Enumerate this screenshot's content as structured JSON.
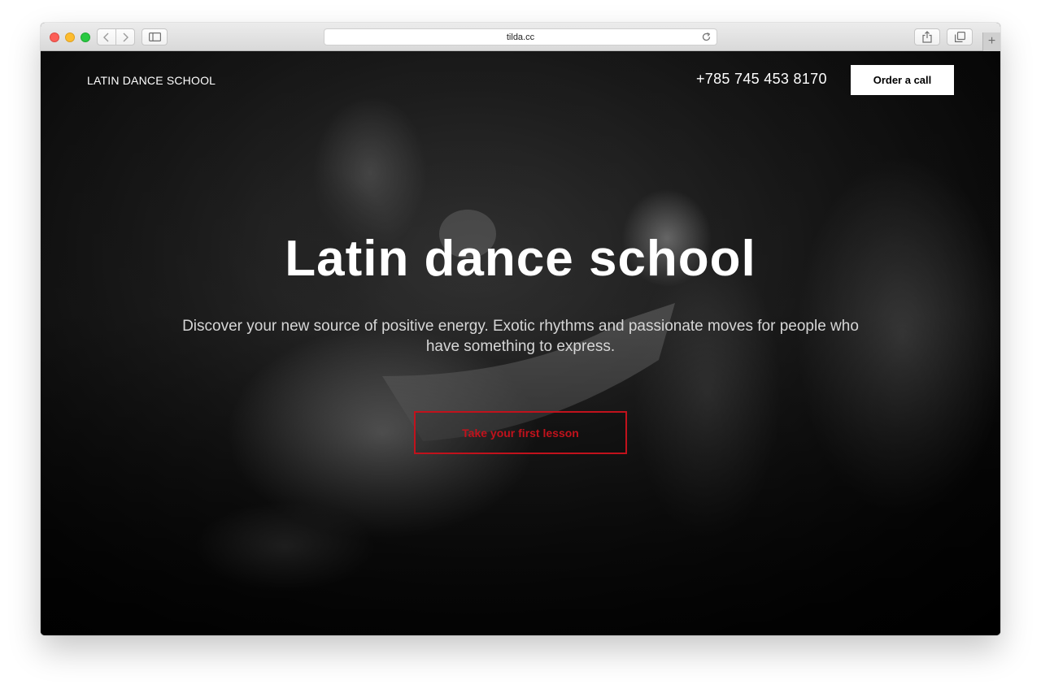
{
  "browser": {
    "url": "tilda.cc"
  },
  "header": {
    "logo": "LATIN DANCE SCHOOL",
    "phone": "+785 745 453 8170",
    "order_button": "Order a call"
  },
  "hero": {
    "title": "Latin dance school",
    "subtitle": "Discover your new source of positive energy. Exotic rhythms and passionate moves for people who have something to express.",
    "cta_button": "Take your first lesson"
  },
  "colors": {
    "accent": "#c1121c",
    "background": "#000000",
    "text": "#ffffff"
  },
  "icons": [
    "back-arrow-icon",
    "forward-arrow-icon",
    "sidebar-icon",
    "reload-icon",
    "share-icon",
    "tabs-icon",
    "new-tab-icon"
  ]
}
